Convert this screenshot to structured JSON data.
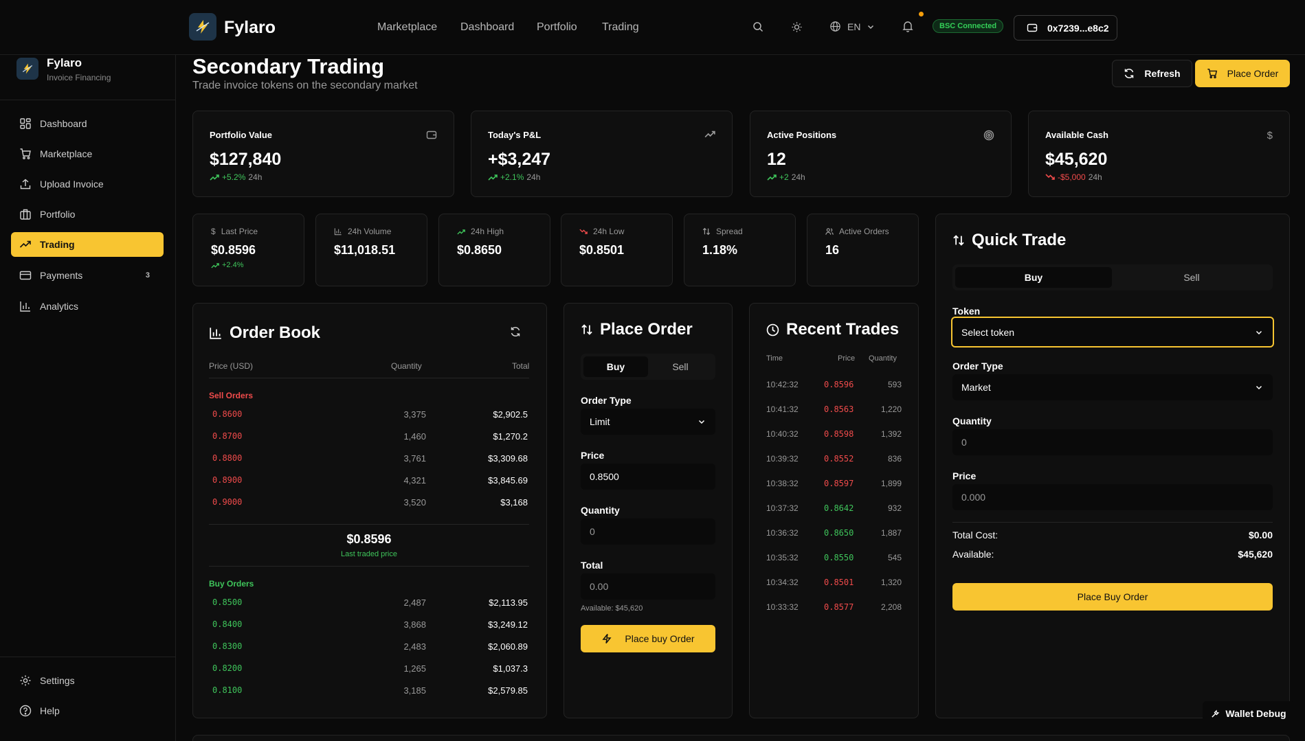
{
  "app": {
    "name": "Fylaro",
    "subtitle": "Invoice Financing"
  },
  "topnav": {
    "links": [
      "Marketplace",
      "Dashboard",
      "Portfolio",
      "Trading"
    ],
    "language": "EN",
    "network_badge": "BSC Connected",
    "wallet_address": "0x7239...e8c2"
  },
  "sidebar": {
    "items": [
      {
        "label": "Dashboard",
        "icon": "dashboard-icon"
      },
      {
        "label": "Marketplace",
        "icon": "cart-icon"
      },
      {
        "label": "Upload Invoice",
        "icon": "upload-icon"
      },
      {
        "label": "Portfolio",
        "icon": "briefcase-icon"
      },
      {
        "label": "Trading",
        "icon": "trending-up-icon",
        "active": true
      },
      {
        "label": "Payments",
        "icon": "credit-card-icon",
        "badge": "3"
      },
      {
        "label": "Analytics",
        "icon": "bar-chart-icon"
      }
    ],
    "footer": [
      {
        "label": "Settings",
        "icon": "gear-icon"
      },
      {
        "label": "Help",
        "icon": "help-icon"
      }
    ]
  },
  "page": {
    "title": "Secondary Trading",
    "subtitle": "Trade invoice tokens on the secondary market",
    "refresh_label": "Refresh",
    "place_order_label": "Place Order"
  },
  "stats": [
    {
      "label": "Portfolio Value",
      "value": "$127,840",
      "change": "+5.2%",
      "period": "24h",
      "trend": "up",
      "icon": "wallet-icon"
    },
    {
      "label": "Today's P&L",
      "value": "+$3,247",
      "change": "+2.1%",
      "period": "24h",
      "trend": "up",
      "icon": "trending-up-icon"
    },
    {
      "label": "Active Positions",
      "value": "12",
      "change": "+2",
      "period": "24h",
      "trend": "up",
      "icon": "target-icon"
    },
    {
      "label": "Available Cash",
      "value": "$45,620",
      "change": "-$5,000",
      "period": "24h",
      "trend": "down",
      "icon": "dollar-icon"
    }
  ],
  "market": [
    {
      "label": "Last Price",
      "value": "$0.8596",
      "change": "+2.4%",
      "icon": "dollar-icon"
    },
    {
      "label": "24h Volume",
      "value": "$11,018.51",
      "icon": "bar-chart-icon"
    },
    {
      "label": "24h High",
      "value": "$0.8650",
      "icon": "trending-up-icon"
    },
    {
      "label": "24h Low",
      "value": "$0.8501",
      "icon": "trending-down-icon"
    },
    {
      "label": "Spread",
      "value": "1.18%",
      "icon": "arrows-updown-icon"
    },
    {
      "label": "Active Orders",
      "value": "16",
      "icon": "users-icon"
    }
  ],
  "order_book": {
    "title": "Order Book",
    "headers": {
      "price": "Price (USD)",
      "quantity": "Quantity",
      "total": "Total"
    },
    "sell_label": "Sell Orders",
    "sells": [
      {
        "price": "0.8600",
        "qty": "3,375",
        "total": "$2,902.5"
      },
      {
        "price": "0.8700",
        "qty": "1,460",
        "total": "$1,270.2"
      },
      {
        "price": "0.8800",
        "qty": "3,761",
        "total": "$3,309.68"
      },
      {
        "price": "0.8900",
        "qty": "4,321",
        "total": "$3,845.69"
      },
      {
        "price": "0.9000",
        "qty": "3,520",
        "total": "$3,168"
      }
    ],
    "last_price": "$0.8596",
    "last_price_label": "Last traded price",
    "buy_label": "Buy Orders",
    "buys": [
      {
        "price": "0.8500",
        "qty": "2,487",
        "total": "$2,113.95"
      },
      {
        "price": "0.8400",
        "qty": "3,868",
        "total": "$3,249.12"
      },
      {
        "price": "0.8300",
        "qty": "2,483",
        "total": "$2,060.89"
      },
      {
        "price": "0.8200",
        "qty": "1,265",
        "total": "$1,037.3"
      },
      {
        "price": "0.8100",
        "qty": "3,185",
        "total": "$2,579.85"
      }
    ]
  },
  "place_order": {
    "title": "Place Order",
    "buy": "Buy",
    "sell": "Sell",
    "order_type_label": "Order Type",
    "order_type": "Limit",
    "price_label": "Price",
    "price": "0.8500",
    "quantity_label": "Quantity",
    "quantity": "0",
    "total_label": "Total",
    "total": "0.00",
    "available": "Available: $45,620",
    "submit": "Place buy Order"
  },
  "recent_trades": {
    "title": "Recent Trades",
    "headers": {
      "time": "Time",
      "price": "Price",
      "quantity": "Quantity"
    },
    "rows": [
      {
        "time": "10:42:32",
        "price": "0.8596",
        "qty": "593",
        "side": "sell"
      },
      {
        "time": "10:41:32",
        "price": "0.8563",
        "qty": "1,220",
        "side": "sell"
      },
      {
        "time": "10:40:32",
        "price": "0.8598",
        "qty": "1,392",
        "side": "sell"
      },
      {
        "time": "10:39:32",
        "price": "0.8552",
        "qty": "836",
        "side": "sell"
      },
      {
        "time": "10:38:32",
        "price": "0.8597",
        "qty": "1,899",
        "side": "sell"
      },
      {
        "time": "10:37:32",
        "price": "0.8642",
        "qty": "932",
        "side": "buy"
      },
      {
        "time": "10:36:32",
        "price": "0.8650",
        "qty": "1,887",
        "side": "buy"
      },
      {
        "time": "10:35:32",
        "price": "0.8550",
        "qty": "545",
        "side": "buy"
      },
      {
        "time": "10:34:32",
        "price": "0.8501",
        "qty": "1,320",
        "side": "sell"
      },
      {
        "time": "10:33:32",
        "price": "0.8577",
        "qty": "2,208",
        "side": "sell"
      }
    ]
  },
  "quick_trade": {
    "title": "Quick Trade",
    "buy": "Buy",
    "sell": "Sell",
    "token_label": "Token",
    "token_placeholder": "Select token",
    "order_type_label": "Order Type",
    "order_type": "Market",
    "quantity_label": "Quantity",
    "quantity_placeholder": "0",
    "price_label": "Price",
    "price_placeholder": "0.000",
    "total_cost_label": "Total Cost:",
    "total_cost": "$0.00",
    "available_label": "Available:",
    "available": "$45,620",
    "submit": "Place Buy Order"
  },
  "debug": {
    "label": "Wallet Debug"
  },
  "colors": {
    "accent": "#f8c531",
    "positive": "#3fc55b",
    "negative": "#f04b4b",
    "background": "#0a0a0a",
    "card": "#0f0f0f"
  }
}
